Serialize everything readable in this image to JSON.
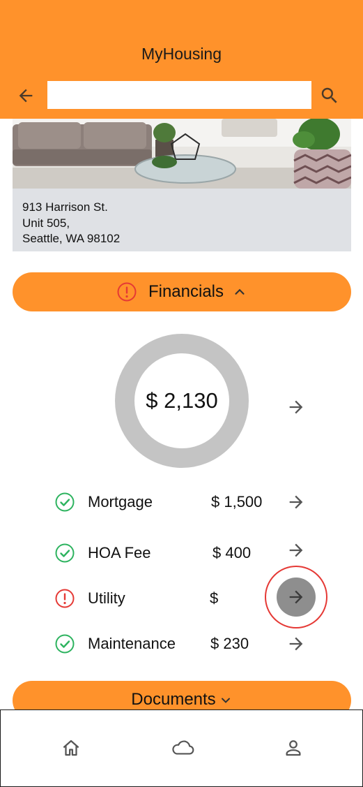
{
  "app": {
    "title": "MyHousing"
  },
  "search": {
    "value": "",
    "placeholder": ""
  },
  "property": {
    "address_line1": "913 Harrison St.",
    "address_line2": "Unit 505,",
    "address_line3": "Seattle, WA 98102"
  },
  "financials": {
    "label": "Financials",
    "status": "alert",
    "expanded": true,
    "total": "$ 2,130",
    "items": [
      {
        "label": "Mortgage",
        "amount": "$ 1,500",
        "status": "ok"
      },
      {
        "label": "HOA Fee",
        "amount": "$ 400",
        "status": "ok"
      },
      {
        "label": "Utility",
        "amount": "$",
        "status": "alert"
      },
      {
        "label": "Maintenance",
        "amount": "$ 230",
        "status": "ok"
      }
    ]
  },
  "documents": {
    "label": "Documents",
    "expanded": false
  },
  "bottom_nav": {
    "items": [
      "home-icon",
      "cloud-icon",
      "profile-icon"
    ]
  },
  "colors": {
    "accent": "#FF922B",
    "ok": "#2DB35F",
    "alert": "#E53935",
    "ring": "#C4C4C4",
    "card": "#DFE1E5"
  }
}
